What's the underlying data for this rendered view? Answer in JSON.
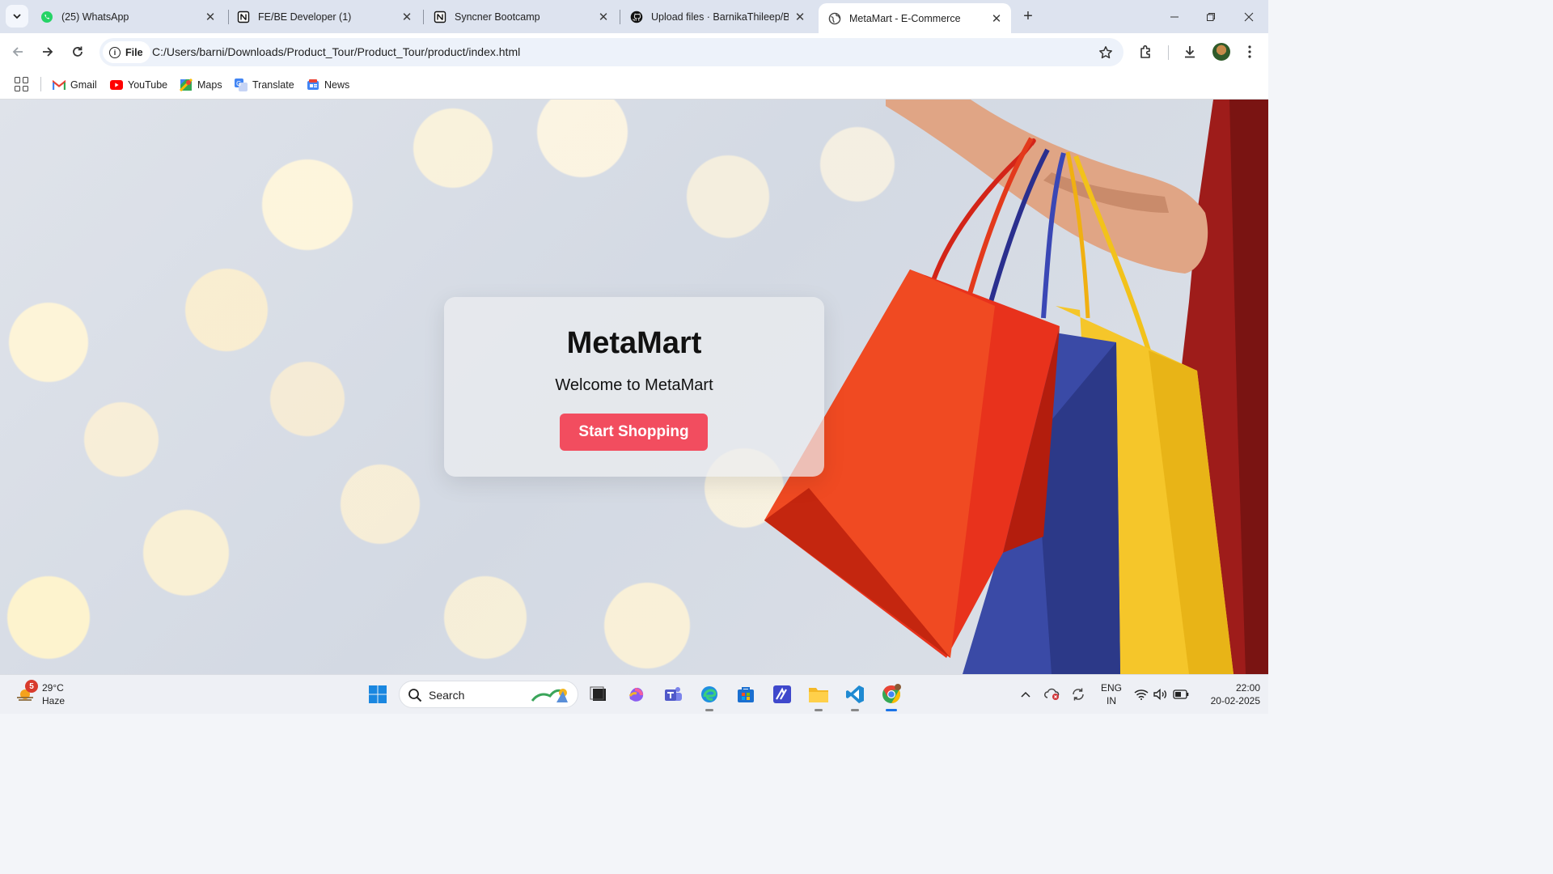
{
  "browser": {
    "tabs": [
      {
        "title": "(25) WhatsApp",
        "icon": "whatsapp-icon",
        "active": false
      },
      {
        "title": "FE/BE Developer (1)",
        "icon": "notion-icon",
        "active": false
      },
      {
        "title": "Syncner Bootcamp",
        "icon": "notion-icon",
        "active": false
      },
      {
        "title": "Upload files · BarnikaThileep/Bc",
        "icon": "github-icon",
        "active": false
      },
      {
        "title": "MetaMart - E-Commerce",
        "icon": "globe-icon",
        "active": true
      }
    ],
    "address": {
      "scheme_label": "File",
      "url": "C:/Users/barni/Downloads/Product_Tour/Product_Tour/product/index.html"
    },
    "bookmarks": [
      {
        "label": "Gmail",
        "icon": "gmail-icon"
      },
      {
        "label": "YouTube",
        "icon": "youtube-icon"
      },
      {
        "label": "Maps",
        "icon": "maps-icon"
      },
      {
        "label": "Translate",
        "icon": "translate-icon"
      },
      {
        "label": "News",
        "icon": "news-icon"
      }
    ]
  },
  "hero": {
    "title": "MetaMart",
    "subtitle": "Welcome to MetaMart",
    "cta_label": "Start Shopping",
    "cta_color": "#f24d5f"
  },
  "taskbar": {
    "weather": {
      "badge": "5",
      "temp": "29°C",
      "condition": "Haze"
    },
    "search_label": "Search",
    "language": {
      "line1": "ENG",
      "line2": "IN"
    },
    "clock": {
      "time": "22:00",
      "date": "20-02-2025"
    }
  }
}
